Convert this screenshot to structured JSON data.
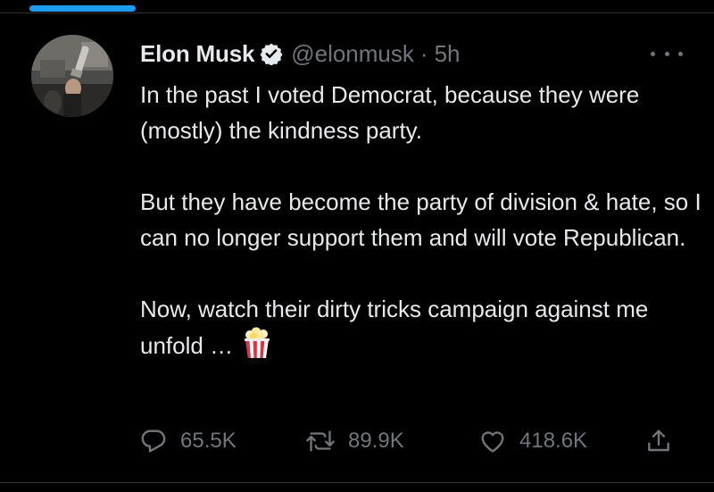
{
  "tweet": {
    "author": {
      "name": "Elon Musk",
      "handle": "@elonmusk",
      "separator": "·",
      "time": "5h",
      "verified": true
    },
    "paragraphs": [
      "In the past I voted Democrat, because they were (mostly) the kindness party.",
      "But they have become the party of division & hate, so I can no longer support them and will vote Republican.",
      "Now, watch their dirty tricks campaign against me unfold …"
    ],
    "emoji": "popcorn-emoji",
    "stats": {
      "replies": "65.5K",
      "retweets": "89.9K",
      "likes": "418.6K"
    }
  },
  "icons": {
    "verified": "verified-badge-icon",
    "more": "more-horizontal-icon",
    "reply": "reply-icon",
    "retweet": "retweet-icon",
    "like": "like-icon",
    "share": "share-icon"
  },
  "colors": {
    "background": "#000000",
    "text": "#e7e9ea",
    "secondary": "#71767b",
    "accent": "#1d9bf0",
    "divider": "#2f3336"
  }
}
